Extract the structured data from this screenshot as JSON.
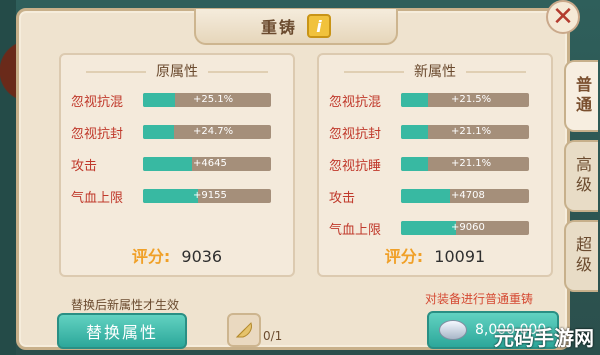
{
  "title": "重铸",
  "info_icon": "i",
  "close_label": "✕",
  "tabs": [
    {
      "label": "普通",
      "active": true
    },
    {
      "label": "高级",
      "active": false
    },
    {
      "label": "超级",
      "active": false
    }
  ],
  "panels": {
    "left": {
      "title": "原属性",
      "rows": [
        {
          "name": "忽视抗混",
          "value": "+25.1%",
          "fill": 0.25
        },
        {
          "name": "忽视抗封",
          "value": "+24.7%",
          "fill": 0.24
        },
        {
          "name": "攻击",
          "value": "+4645",
          "fill": 0.38
        },
        {
          "name": "气血上限",
          "value": "+9155",
          "fill": 0.43
        }
      ],
      "score_label": "评分:",
      "score": "9036"
    },
    "right": {
      "title": "新属性",
      "rows": [
        {
          "name": "忽视抗混",
          "value": "+21.5%",
          "fill": 0.21
        },
        {
          "name": "忽视抗封",
          "value": "+21.1%",
          "fill": 0.21
        },
        {
          "name": "忽视抗睡",
          "value": "+21.1%",
          "fill": 0.21
        },
        {
          "name": "攻击",
          "value": "+4708",
          "fill": 0.38
        },
        {
          "name": "气血上限",
          "value": "+9060",
          "fill": 0.43
        }
      ],
      "score_label": "评分:",
      "score": "10091"
    }
  },
  "notes": {
    "left": "替换后新属性才生效",
    "right": "对装备进行普通重铸"
  },
  "buttons": {
    "replace": "替换属性",
    "cost": "8,000,000"
  },
  "slot": {
    "count": "0/1"
  },
  "watermark": "元码手游网"
}
